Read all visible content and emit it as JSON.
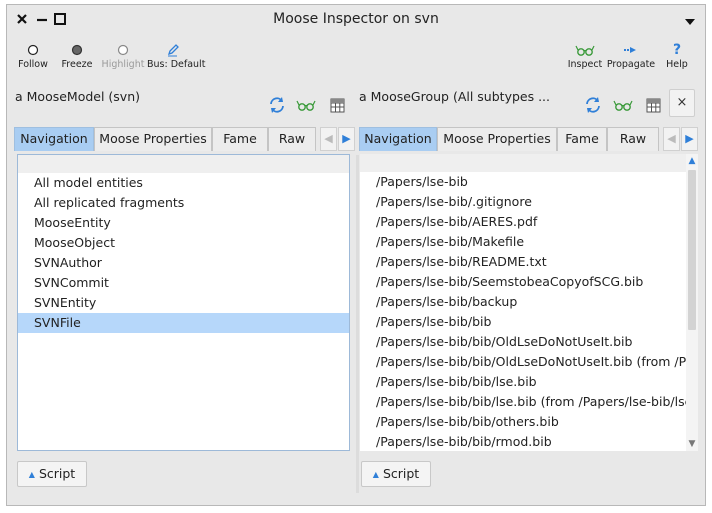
{
  "window": {
    "title": "Moose Inspector on svn"
  },
  "toolbar_left": [
    {
      "id": "follow",
      "label": "Follow",
      "icon": "hollow-circle-icon",
      "enabled": true
    },
    {
      "id": "freeze",
      "label": "Freeze",
      "icon": "filled-circle-icon",
      "enabled": true
    },
    {
      "id": "highlight",
      "label": "Highlight",
      "icon": "hollow-circle-icon",
      "enabled": false
    },
    {
      "id": "bus",
      "label": "Bus: Default",
      "icon": "pencil-icon",
      "enabled": true
    }
  ],
  "toolbar_right": [
    {
      "id": "inspect",
      "label": "Inspect",
      "icon": "glasses-icon"
    },
    {
      "id": "propagate",
      "label": "Propagate",
      "icon": "arrow-right-icon"
    },
    {
      "id": "help",
      "label": "Help",
      "icon": "question-icon"
    }
  ],
  "left_pane": {
    "title": "a MooseModel (svn)",
    "tabs": [
      "Navigation",
      "Moose Properties",
      "Fame",
      "Raw"
    ],
    "active_tab": 0,
    "items": [
      "All model entities",
      "All replicated fragments",
      "MooseEntity",
      "MooseObject",
      "SVNAuthor",
      "SVNCommit",
      "SVNEntity",
      "SVNFile"
    ],
    "selected_index": 7,
    "script_label": "Script"
  },
  "right_pane": {
    "title": "a MooseGroup (All subtypes ...",
    "tabs": [
      "Navigation",
      "Moose Properties",
      "Fame",
      "Raw"
    ],
    "active_tab": 0,
    "items": [
      "/Papers/lse-bib",
      "/Papers/lse-bib/.gitignore",
      "/Papers/lse-bib/AERES.pdf",
      "/Papers/lse-bib/Makefile",
      "/Papers/lse-bib/README.txt",
      "/Papers/lse-bib/SeemstobeaCopyofSCG.bib",
      "/Papers/lse-bib/backup",
      "/Papers/lse-bib/bib",
      "/Papers/lse-bib/bib/OldLseDoNotUseIt.bib",
      "/Papers/lse-bib/bib/OldLseDoNotUseIt.bib (from /Papers/lse-bib/bib)",
      "/Papers/lse-bib/bib/lse.bib",
      "/Papers/lse-bib/bib/lse.bib (from /Papers/lse-bib/lse.bib)",
      "/Papers/lse-bib/bib/others.bib",
      "/Papers/lse-bib/bib/rmod.bib"
    ],
    "script_label": "Script",
    "close_label": "×"
  },
  "colors": {
    "accent": "#2f7fd8",
    "selection": "#b6d7fa",
    "active_tab": "#a9cdf2",
    "icon_green": "#3a9a3a"
  }
}
